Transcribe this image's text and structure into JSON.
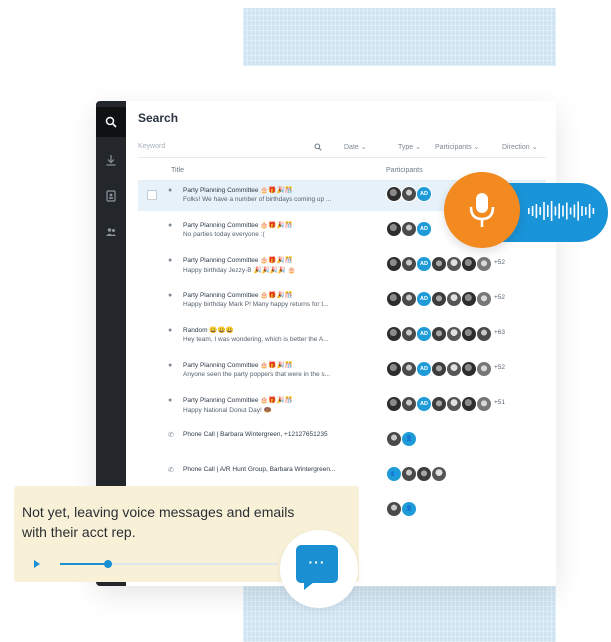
{
  "search": {
    "title": "Search",
    "keyword_placeholder": "Keyword",
    "filters": [
      "Date ⌄",
      "Type ⌄",
      "Participants ⌄",
      "Direction ⌄"
    ],
    "columns": {
      "title": "Title",
      "participants": "Participants"
    }
  },
  "rows": [
    {
      "icon": "chat-icon",
      "line1": "Party Planning Committee 🎂🎁🎉🎊",
      "line2": "Folks! We have a number of birthdays coming up ...",
      "avatars": [
        "p1",
        "p2",
        "AD"
      ],
      "more": ""
    },
    {
      "icon": "chat-icon",
      "line1": "Party Planning Committee 🎂🎁🎉🎊",
      "line2": "No parties today everyone :(",
      "avatars": [
        "p1",
        "p2",
        "AD"
      ],
      "more": ""
    },
    {
      "icon": "chat-icon",
      "line1": "Party Planning Committee 🎂🎁🎉🎊",
      "line2": "Happy birthday Jezzy-B 🎉🎉🎉🎉 🎂",
      "avatars": [
        "p1",
        "p2",
        "AD",
        "p3",
        "p4",
        "p1",
        "p5"
      ],
      "more": "+52"
    },
    {
      "icon": "chat-icon",
      "line1": "Party Planning Committee 🎂🎁🎉🎊",
      "line2": "Happy birthday Mark P! Many happy returns for t...",
      "avatars": [
        "p1",
        "p2",
        "AD",
        "p3",
        "p4",
        "p1",
        "p5"
      ],
      "more": "+52"
    },
    {
      "icon": "chat-icon",
      "line1": "Random 😀😀😀",
      "line2": "Hey team, I was wondering, which is better the A...",
      "avatars": [
        "p1",
        "p2",
        "AD",
        "p3",
        "p4",
        "p1",
        "p2"
      ],
      "more": "+63"
    },
    {
      "icon": "chat-icon",
      "line1": "Party Planning Committee 🎂🎁🎉🎊",
      "line2": "Anyone seen the party poppers that were in the s...",
      "avatars": [
        "p1",
        "p2",
        "AD",
        "p3",
        "p4",
        "p1",
        "p5"
      ],
      "more": "+52"
    },
    {
      "icon": "chat-icon",
      "line1": "Party Planning Committee 🎂🎁🎉🎊",
      "line2": "Happy National Donut Day! 🍩",
      "avatars": [
        "p1",
        "p2",
        "AD",
        "p3",
        "p4",
        "p1",
        "p5"
      ],
      "more": "+51"
    },
    {
      "icon": "phone-icon",
      "line1": "Phone Call | Barbara Wintergreen, +12127651235",
      "line2": "",
      "avatars": [
        "p2",
        "person"
      ],
      "more": ""
    },
    {
      "icon": "phone-icon",
      "line1": "Phone Call | A/R Hunt Group, Barbara Wintergreen...",
      "line2": "",
      "avatars": [
        "group",
        "p2",
        "p3",
        "p4"
      ],
      "more": ""
    },
    {
      "icon": "phone-icon",
      "line1": "",
      "line2": "",
      "avatars": [
        "p2",
        "person"
      ],
      "more": ""
    }
  ],
  "caption": {
    "text": "Not yet, leaving voice messages and emails with their acct rep.",
    "progress": 0.22
  },
  "colors": {
    "accent": "#1a8fd2",
    "mic": "#f28a1f",
    "sidebar": "#23272b"
  },
  "icons": [
    "search-icon",
    "download-icon",
    "contacts-book-icon",
    "people-icon",
    "microphone-icon",
    "sound-wave-icon",
    "chat-bubble-icon",
    "play-icon"
  ]
}
